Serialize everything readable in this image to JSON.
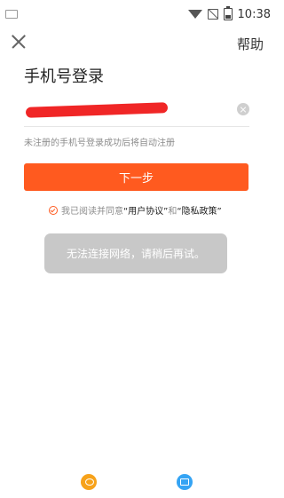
{
  "status_bar": {
    "time": "10:38",
    "icons": [
      "keyboard-icon",
      "wifi-icon",
      "no-sim-icon",
      "battery-icon"
    ]
  },
  "header": {
    "close_icon": "close-icon",
    "help_label": "帮助"
  },
  "login": {
    "title": "手机号登录",
    "phone_value": "",
    "clear_icon": "clear-icon",
    "hint": "未注册的手机号登录成功后将自动注册",
    "next_label": "下一步",
    "agreement_prefix": "我已阅读并同意",
    "agreement_link1": "“用户协议”",
    "agreement_and": "和",
    "agreement_link2": "“隐私政策”",
    "toast": "无法连接网络，请稍后再试。"
  },
  "social": {
    "weibo_icon": "weibo-icon",
    "mail_icon": "mail-icon"
  },
  "colors": {
    "accent": "#ff5a1f",
    "toast_bg": "#c8c8c8",
    "hint_text": "#8c8c8c"
  }
}
